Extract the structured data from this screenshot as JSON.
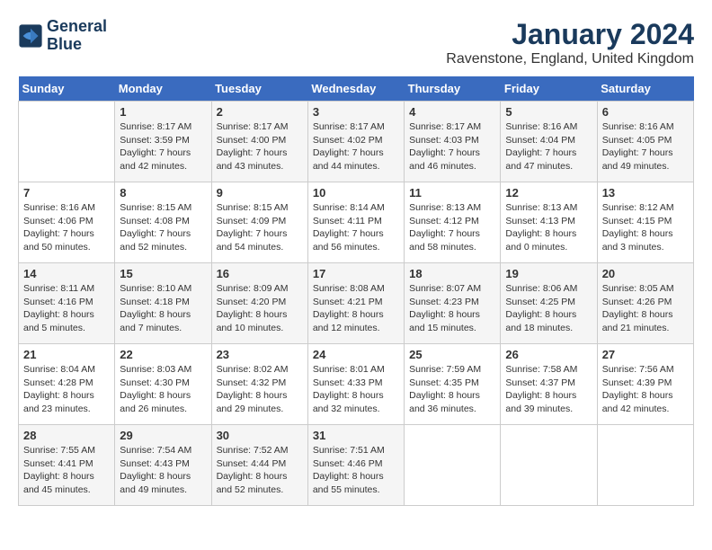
{
  "header": {
    "logo_line1": "General",
    "logo_line2": "Blue",
    "month": "January 2024",
    "location": "Ravenstone, England, United Kingdom"
  },
  "days_of_week": [
    "Sunday",
    "Monday",
    "Tuesday",
    "Wednesday",
    "Thursday",
    "Friday",
    "Saturday"
  ],
  "weeks": [
    [
      {
        "day": "",
        "sunrise": "",
        "sunset": "",
        "daylight": ""
      },
      {
        "day": "1",
        "sunrise": "Sunrise: 8:17 AM",
        "sunset": "Sunset: 3:59 PM",
        "daylight": "Daylight: 7 hours and 42 minutes."
      },
      {
        "day": "2",
        "sunrise": "Sunrise: 8:17 AM",
        "sunset": "Sunset: 4:00 PM",
        "daylight": "Daylight: 7 hours and 43 minutes."
      },
      {
        "day": "3",
        "sunrise": "Sunrise: 8:17 AM",
        "sunset": "Sunset: 4:02 PM",
        "daylight": "Daylight: 7 hours and 44 minutes."
      },
      {
        "day": "4",
        "sunrise": "Sunrise: 8:17 AM",
        "sunset": "Sunset: 4:03 PM",
        "daylight": "Daylight: 7 hours and 46 minutes."
      },
      {
        "day": "5",
        "sunrise": "Sunrise: 8:16 AM",
        "sunset": "Sunset: 4:04 PM",
        "daylight": "Daylight: 7 hours and 47 minutes."
      },
      {
        "day": "6",
        "sunrise": "Sunrise: 8:16 AM",
        "sunset": "Sunset: 4:05 PM",
        "daylight": "Daylight: 7 hours and 49 minutes."
      }
    ],
    [
      {
        "day": "7",
        "sunrise": "Sunrise: 8:16 AM",
        "sunset": "Sunset: 4:06 PM",
        "daylight": "Daylight: 7 hours and 50 minutes."
      },
      {
        "day": "8",
        "sunrise": "Sunrise: 8:15 AM",
        "sunset": "Sunset: 4:08 PM",
        "daylight": "Daylight: 7 hours and 52 minutes."
      },
      {
        "day": "9",
        "sunrise": "Sunrise: 8:15 AM",
        "sunset": "Sunset: 4:09 PM",
        "daylight": "Daylight: 7 hours and 54 minutes."
      },
      {
        "day": "10",
        "sunrise": "Sunrise: 8:14 AM",
        "sunset": "Sunset: 4:11 PM",
        "daylight": "Daylight: 7 hours and 56 minutes."
      },
      {
        "day": "11",
        "sunrise": "Sunrise: 8:13 AM",
        "sunset": "Sunset: 4:12 PM",
        "daylight": "Daylight: 7 hours and 58 minutes."
      },
      {
        "day": "12",
        "sunrise": "Sunrise: 8:13 AM",
        "sunset": "Sunset: 4:13 PM",
        "daylight": "Daylight: 8 hours and 0 minutes."
      },
      {
        "day": "13",
        "sunrise": "Sunrise: 8:12 AM",
        "sunset": "Sunset: 4:15 PM",
        "daylight": "Daylight: 8 hours and 3 minutes."
      }
    ],
    [
      {
        "day": "14",
        "sunrise": "Sunrise: 8:11 AM",
        "sunset": "Sunset: 4:16 PM",
        "daylight": "Daylight: 8 hours and 5 minutes."
      },
      {
        "day": "15",
        "sunrise": "Sunrise: 8:10 AM",
        "sunset": "Sunset: 4:18 PM",
        "daylight": "Daylight: 8 hours and 7 minutes."
      },
      {
        "day": "16",
        "sunrise": "Sunrise: 8:09 AM",
        "sunset": "Sunset: 4:20 PM",
        "daylight": "Daylight: 8 hours and 10 minutes."
      },
      {
        "day": "17",
        "sunrise": "Sunrise: 8:08 AM",
        "sunset": "Sunset: 4:21 PM",
        "daylight": "Daylight: 8 hours and 12 minutes."
      },
      {
        "day": "18",
        "sunrise": "Sunrise: 8:07 AM",
        "sunset": "Sunset: 4:23 PM",
        "daylight": "Daylight: 8 hours and 15 minutes."
      },
      {
        "day": "19",
        "sunrise": "Sunrise: 8:06 AM",
        "sunset": "Sunset: 4:25 PM",
        "daylight": "Daylight: 8 hours and 18 minutes."
      },
      {
        "day": "20",
        "sunrise": "Sunrise: 8:05 AM",
        "sunset": "Sunset: 4:26 PM",
        "daylight": "Daylight: 8 hours and 21 minutes."
      }
    ],
    [
      {
        "day": "21",
        "sunrise": "Sunrise: 8:04 AM",
        "sunset": "Sunset: 4:28 PM",
        "daylight": "Daylight: 8 hours and 23 minutes."
      },
      {
        "day": "22",
        "sunrise": "Sunrise: 8:03 AM",
        "sunset": "Sunset: 4:30 PM",
        "daylight": "Daylight: 8 hours and 26 minutes."
      },
      {
        "day": "23",
        "sunrise": "Sunrise: 8:02 AM",
        "sunset": "Sunset: 4:32 PM",
        "daylight": "Daylight: 8 hours and 29 minutes."
      },
      {
        "day": "24",
        "sunrise": "Sunrise: 8:01 AM",
        "sunset": "Sunset: 4:33 PM",
        "daylight": "Daylight: 8 hours and 32 minutes."
      },
      {
        "day": "25",
        "sunrise": "Sunrise: 7:59 AM",
        "sunset": "Sunset: 4:35 PM",
        "daylight": "Daylight: 8 hours and 36 minutes."
      },
      {
        "day": "26",
        "sunrise": "Sunrise: 7:58 AM",
        "sunset": "Sunset: 4:37 PM",
        "daylight": "Daylight: 8 hours and 39 minutes."
      },
      {
        "day": "27",
        "sunrise": "Sunrise: 7:56 AM",
        "sunset": "Sunset: 4:39 PM",
        "daylight": "Daylight: 8 hours and 42 minutes."
      }
    ],
    [
      {
        "day": "28",
        "sunrise": "Sunrise: 7:55 AM",
        "sunset": "Sunset: 4:41 PM",
        "daylight": "Daylight: 8 hours and 45 minutes."
      },
      {
        "day": "29",
        "sunrise": "Sunrise: 7:54 AM",
        "sunset": "Sunset: 4:43 PM",
        "daylight": "Daylight: 8 hours and 49 minutes."
      },
      {
        "day": "30",
        "sunrise": "Sunrise: 7:52 AM",
        "sunset": "Sunset: 4:44 PM",
        "daylight": "Daylight: 8 hours and 52 minutes."
      },
      {
        "day": "31",
        "sunrise": "Sunrise: 7:51 AM",
        "sunset": "Sunset: 4:46 PM",
        "daylight": "Daylight: 8 hours and 55 minutes."
      },
      {
        "day": "",
        "sunrise": "",
        "sunset": "",
        "daylight": ""
      },
      {
        "day": "",
        "sunrise": "",
        "sunset": "",
        "daylight": ""
      },
      {
        "day": "",
        "sunrise": "",
        "sunset": "",
        "daylight": ""
      }
    ]
  ]
}
